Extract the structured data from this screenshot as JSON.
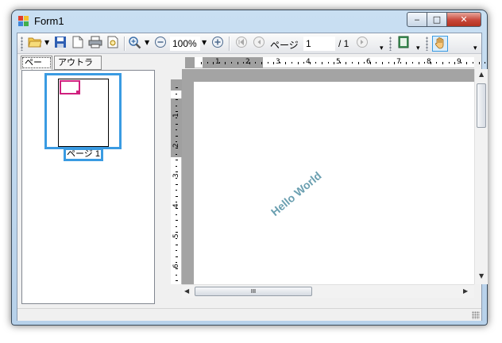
{
  "window": {
    "title": "Form1"
  },
  "caption_buttons": {
    "minimize": "‒",
    "maximize": "□",
    "close": "✕"
  },
  "toolbar": {
    "zoom_value": "100%",
    "page_label": "ページ",
    "page_value": "1",
    "page_total": "/ 1",
    "icons": [
      "open-folder-icon",
      "save-icon",
      "page-setup-icon",
      "print-icon",
      "print-preview-icon",
      "zoom-in-icon",
      "zoom-out-icon",
      "zoom-plus-icon",
      "first-page-icon",
      "previous-page-icon",
      "next-page-icon",
      "book-icon",
      "hand-tool-icon"
    ]
  },
  "left_panel": {
    "tabs": [
      {
        "label": "ページ"
      },
      {
        "label": "アウトライン"
      }
    ],
    "thumbnail_label": "ページ 1"
  },
  "rulers": {
    "horizontal": [
      "1",
      "2",
      "3",
      "4",
      "5",
      "6",
      "7",
      "8",
      "9"
    ],
    "vertical": [
      "1",
      "2",
      "3",
      "4",
      "5",
      "6"
    ]
  },
  "document": {
    "text": "Hello World",
    "text_color": "#6a9fb0"
  },
  "hscroll": {
    "grip": "III"
  },
  "colors": {
    "accent": "#3a9be2",
    "thumbnail_mark": "#d0207e",
    "canvas": "#a4a4a4"
  }
}
